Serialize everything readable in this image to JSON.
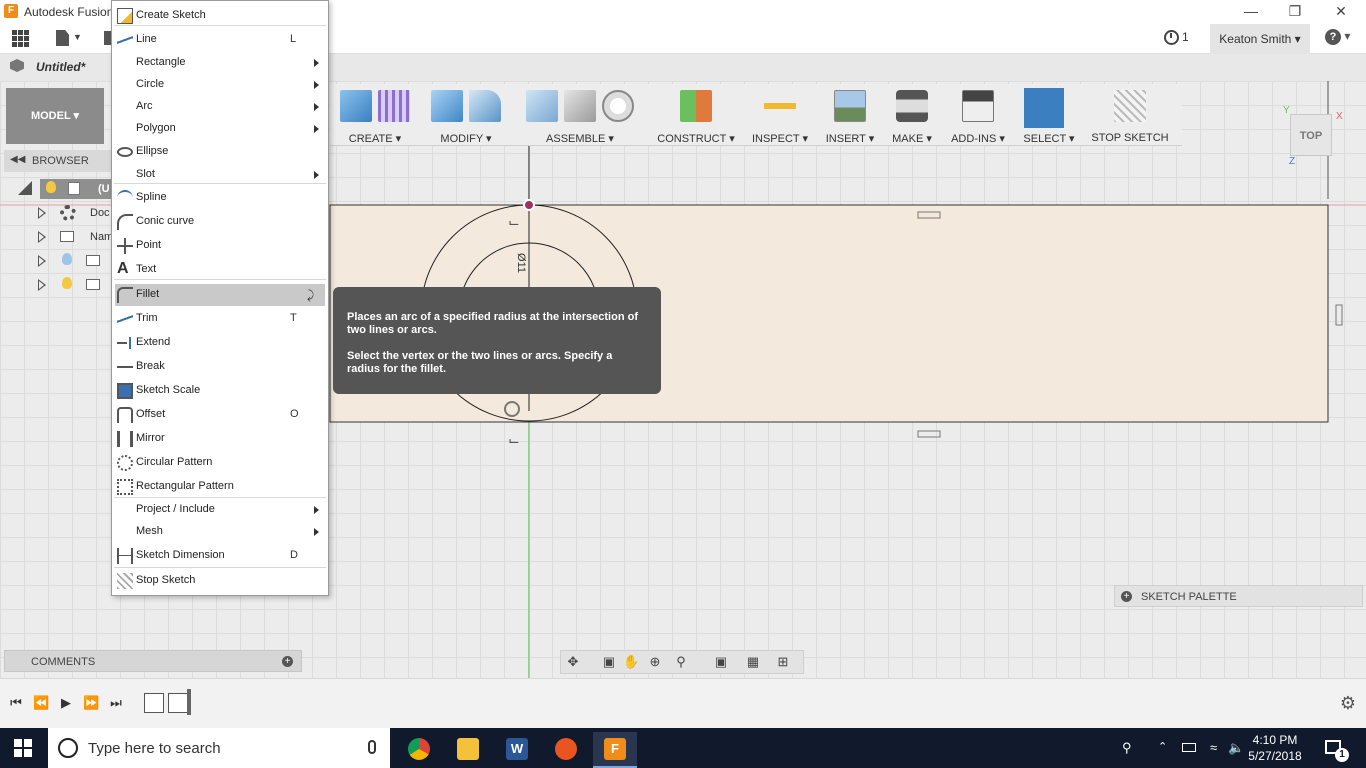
{
  "window": {
    "title": "Autodesk Fusion",
    "app_letter": "F"
  },
  "apptoolbar": {
    "jobs_count": "1",
    "user": "Keaton Smith ▾",
    "help": "▾"
  },
  "document": {
    "name": "Untitled*"
  },
  "workspace": {
    "label": "MODEL ▾"
  },
  "ribbon": {
    "groups": [
      {
        "label": "CREATE ▾"
      },
      {
        "label": "MODIFY ▾"
      },
      {
        "label": "ASSEMBLE ▾"
      },
      {
        "label": "CONSTRUCT ▾"
      },
      {
        "label": "INSPECT ▾"
      },
      {
        "label": "INSERT ▾"
      },
      {
        "label": "MAKE ▾"
      },
      {
        "label": "ADD-INS ▾"
      },
      {
        "label": "SELECT ▾"
      },
      {
        "label": "STOP SKETCH"
      }
    ]
  },
  "browser": {
    "title": "BROWSER",
    "items": [
      {
        "label": "(U"
      },
      {
        "label": "Doc"
      },
      {
        "label": "Nam"
      }
    ]
  },
  "comments": {
    "label": "COMMENTS"
  },
  "sketch_palette": {
    "label": "SKETCH PALETTE"
  },
  "viewcube": {
    "face": "TOP",
    "axis_x": "X",
    "axis_y": "Y",
    "axis_z": "Z"
  },
  "sketch": {
    "dimension_text": "Ø11"
  },
  "menu": {
    "items": [
      {
        "label": "Create Sketch",
        "shortcut": "",
        "submenu": false,
        "icon": "create-sketch-icon"
      },
      {
        "label": "Line",
        "shortcut": "L",
        "submenu": false,
        "icon": "line-icon"
      },
      {
        "label": "Rectangle",
        "shortcut": "",
        "submenu": true,
        "icon": ""
      },
      {
        "label": "Circle",
        "shortcut": "",
        "submenu": true,
        "icon": ""
      },
      {
        "label": "Arc",
        "shortcut": "",
        "submenu": true,
        "icon": ""
      },
      {
        "label": "Polygon",
        "shortcut": "",
        "submenu": true,
        "icon": ""
      },
      {
        "label": "Ellipse",
        "shortcut": "",
        "submenu": false,
        "icon": "ellipse-icon"
      },
      {
        "label": "Slot",
        "shortcut": "",
        "submenu": true,
        "icon": ""
      },
      {
        "label": "Spline",
        "shortcut": "",
        "submenu": false,
        "icon": "spline-icon"
      },
      {
        "label": "Conic curve",
        "shortcut": "",
        "submenu": false,
        "icon": "conic-curve-icon"
      },
      {
        "label": "Point",
        "shortcut": "",
        "submenu": false,
        "icon": "point-icon"
      },
      {
        "label": "Text",
        "shortcut": "",
        "submenu": false,
        "icon": "text-icon"
      },
      {
        "label": "Fillet",
        "shortcut": "",
        "submenu": false,
        "icon": "fillet-icon"
      },
      {
        "label": "Trim",
        "shortcut": "T",
        "submenu": false,
        "icon": "trim-icon"
      },
      {
        "label": "Extend",
        "shortcut": "",
        "submenu": false,
        "icon": "extend-icon"
      },
      {
        "label": "Break",
        "shortcut": "",
        "submenu": false,
        "icon": "break-icon"
      },
      {
        "label": "Sketch Scale",
        "shortcut": "",
        "submenu": false,
        "icon": "sketch-scale-icon"
      },
      {
        "label": "Offset",
        "shortcut": "O",
        "submenu": false,
        "icon": "offset-icon"
      },
      {
        "label": "Mirror",
        "shortcut": "",
        "submenu": false,
        "icon": "mirror-icon"
      },
      {
        "label": "Circular Pattern",
        "shortcut": "",
        "submenu": false,
        "icon": "circular-pattern-icon"
      },
      {
        "label": "Rectangular Pattern",
        "shortcut": "",
        "submenu": false,
        "icon": "rectangular-pattern-icon"
      },
      {
        "label": "Project / Include",
        "shortcut": "",
        "submenu": true,
        "icon": ""
      },
      {
        "label": "Mesh",
        "shortcut": "",
        "submenu": true,
        "icon": ""
      },
      {
        "label": "Sketch Dimension",
        "shortcut": "D",
        "submenu": false,
        "icon": "sketch-dimension-icon"
      },
      {
        "label": "Stop Sketch",
        "shortcut": "",
        "submenu": false,
        "icon": "stop-sketch-icon"
      }
    ]
  },
  "tooltip": {
    "line1": "Places an arc of a specified radius at the intersection of two lines or arcs.",
    "line2": "Select the vertex or the two lines or arcs. Specify a radius for the fillet."
  },
  "taskbar": {
    "search_placeholder": "Type here to search",
    "time": "4:10 PM",
    "date": "5/27/2018",
    "notification_count": "1"
  },
  "colors": {
    "accent_blue": "#3c7fc1",
    "sketch_fill": "#f3e9dc",
    "taskbar": "#101a2c",
    "tooltip_bg": "#555555"
  }
}
